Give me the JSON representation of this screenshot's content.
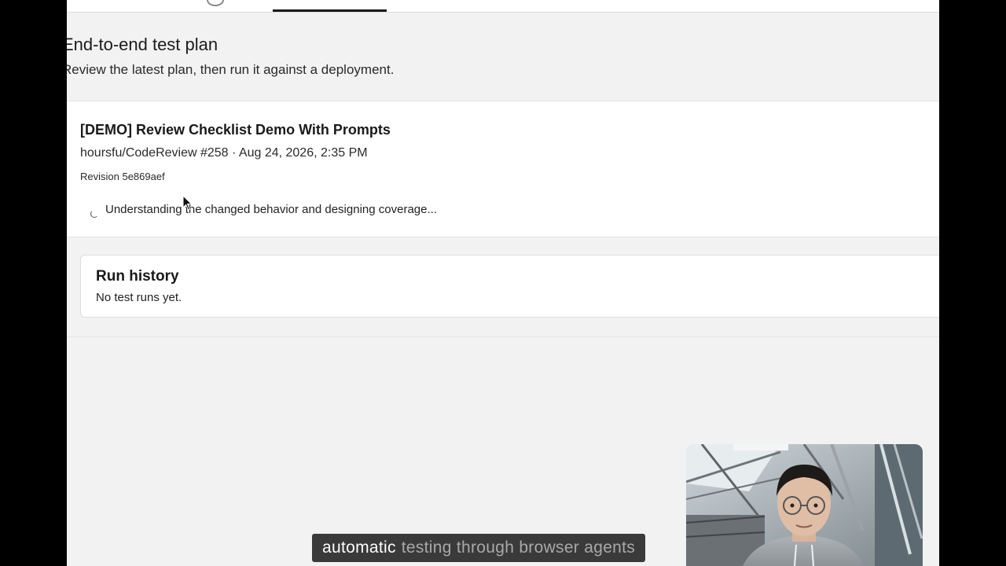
{
  "page": {
    "title": "End-to-end test plan",
    "subtitle": "Review the latest plan, then run it against a deployment."
  },
  "plan": {
    "title": "[DEMO] Review Checklist Demo With Prompts",
    "meta": "hoursfu/CodeReview #258 · Aug 24, 2026, 2:35 PM",
    "revision": "Revision 5e869aef",
    "status": "Understanding the changed behavior and designing coverage..."
  },
  "run_history": {
    "title": "Run history",
    "empty_text": "No test runs yet."
  },
  "caption": {
    "active_word": "automatic",
    "rest": "testing through browser agents"
  },
  "colors": {
    "app_background": "#f2f2f2",
    "card_background": "#ffffff",
    "text": "#1a1a1a",
    "caption_background": "#202020"
  },
  "icons": {
    "status": "spinner-icon",
    "pointer": "cursor-arrow-icon"
  }
}
